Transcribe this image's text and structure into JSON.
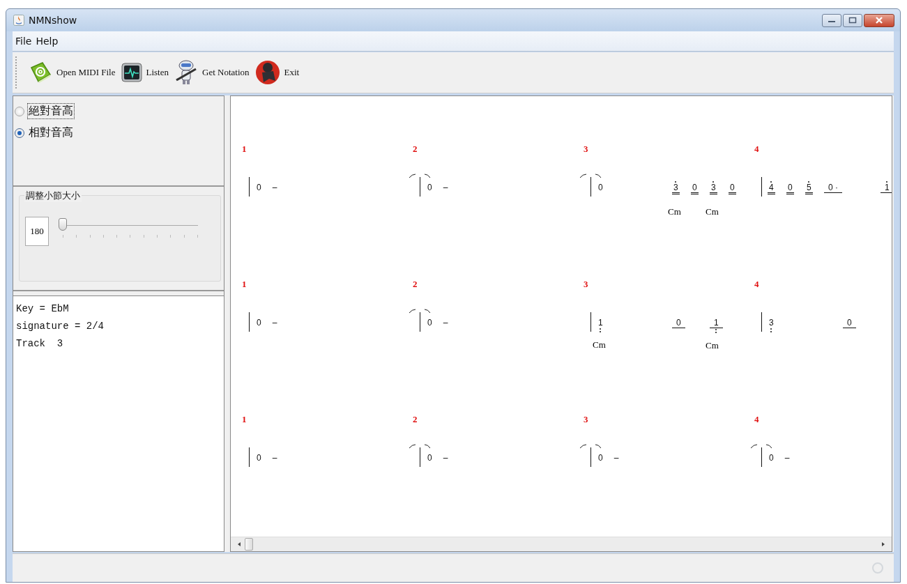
{
  "window": {
    "title": "NMNshow"
  },
  "menu": [
    {
      "label": "File"
    },
    {
      "label": "Help"
    }
  ],
  "toolbar": [
    {
      "label": "Open MIDI File",
      "kind": "book"
    },
    {
      "label": "Listen",
      "kind": "monitor"
    },
    {
      "label": "Get Notation",
      "kind": "robot"
    },
    {
      "label": "Exit",
      "kind": "runner"
    }
  ],
  "pitch_modes": [
    {
      "label": "絕對音高",
      "selected": false,
      "focused": true
    },
    {
      "label": "相對音高",
      "selected": true,
      "focused": false
    }
  ],
  "measure_size": {
    "title": "調整小節大小",
    "value": "180",
    "level": 0
  },
  "info_lines": [
    "Key = EbM",
    "signature = 2/4",
    "Track  3"
  ],
  "score": {
    "rows": [
      {
        "measures": [
          {
            "number": "1",
            "tie": false,
            "events": [
              {
                "kind": "quarter",
                "text": "0",
                "dot_above": false,
                "dots_below": false,
                "extension": "–"
              }
            ]
          },
          {
            "number": "2",
            "tie": true,
            "events": [
              {
                "kind": "quarter",
                "text": "0",
                "dot_above": false,
                "dots_below": false,
                "extension": "–"
              }
            ]
          },
          {
            "number": "3",
            "tie": true,
            "events": [
              {
                "kind": "quarter",
                "text": "0",
                "dot_above": false,
                "dots_below": false
              },
              {
                "kind": "sixteenth",
                "text": "3",
                "dot_above": true,
                "dots_below": false,
                "chord": "Cm"
              },
              {
                "kind": "sixteenth",
                "text": "0",
                "dot_above": false,
                "dots_below": false
              },
              {
                "kind": "sixteenth",
                "text": "3",
                "dot_above": true,
                "dots_below": false,
                "chord": "Cm"
              },
              {
                "kind": "sixteenth",
                "text": "0",
                "dot_above": false,
                "dots_below": false
              }
            ]
          },
          {
            "number": "4",
            "tie": false,
            "events": [
              {
                "kind": "sixteenth",
                "text": "4",
                "dot_above": true,
                "dots_below": false
              },
              {
                "kind": "sixteenth",
                "text": "0",
                "dot_above": false,
                "dots_below": false
              },
              {
                "kind": "sixteenth",
                "text": "5",
                "dot_above": true,
                "dots_below": false
              },
              {
                "kind": "dotted_eighth",
                "text": "0 ·",
                "dot_above": false,
                "dots_below": false
              },
              {
                "kind": "eighth",
                "text": "1",
                "dot_above": true,
                "dots_below": false
              }
            ]
          }
        ]
      },
      {
        "measures": [
          {
            "number": "1",
            "tie": false,
            "events": [
              {
                "kind": "quarter",
                "text": "0",
                "dot_above": false,
                "dots_below": false,
                "extension": "–"
              }
            ]
          },
          {
            "number": "2",
            "tie": true,
            "events": [
              {
                "kind": "quarter",
                "text": "0",
                "dot_above": false,
                "dots_below": false,
                "extension": "–"
              }
            ]
          },
          {
            "number": "3",
            "tie": false,
            "events": [
              {
                "kind": "quarter",
                "text": "1",
                "dot_above": false,
                "dots_below": true,
                "chord": "Cm"
              },
              {
                "kind": "eighth",
                "text": "0",
                "dot_above": false,
                "dots_below": false
              },
              {
                "kind": "eighth",
                "text": "1",
                "dot_above": false,
                "dots_below": true,
                "chord": "Cm"
              }
            ]
          },
          {
            "number": "4",
            "tie": false,
            "events": [
              {
                "kind": "quarter",
                "text": "3",
                "dot_above": false,
                "dots_below": true
              },
              {
                "kind": "eighth",
                "text": "0",
                "dot_above": false,
                "dots_below": false
              }
            ]
          }
        ]
      },
      {
        "measures": [
          {
            "number": "1",
            "tie": false,
            "events": [
              {
                "kind": "quarter",
                "text": "0",
                "dot_above": false,
                "dots_below": false,
                "extension": "–"
              }
            ]
          },
          {
            "number": "2",
            "tie": true,
            "events": [
              {
                "kind": "quarter",
                "text": "0",
                "dot_above": false,
                "dots_below": false,
                "extension": "–"
              }
            ]
          },
          {
            "number": "3",
            "tie": true,
            "events": [
              {
                "kind": "quarter",
                "text": "0",
                "dot_above": false,
                "dots_below": false,
                "extension": "–"
              }
            ]
          },
          {
            "number": "4",
            "tie": true,
            "events": [
              {
                "kind": "quarter",
                "text": "0",
                "dot_above": false,
                "dots_below": false,
                "extension": "–"
              }
            ]
          }
        ]
      }
    ]
  }
}
